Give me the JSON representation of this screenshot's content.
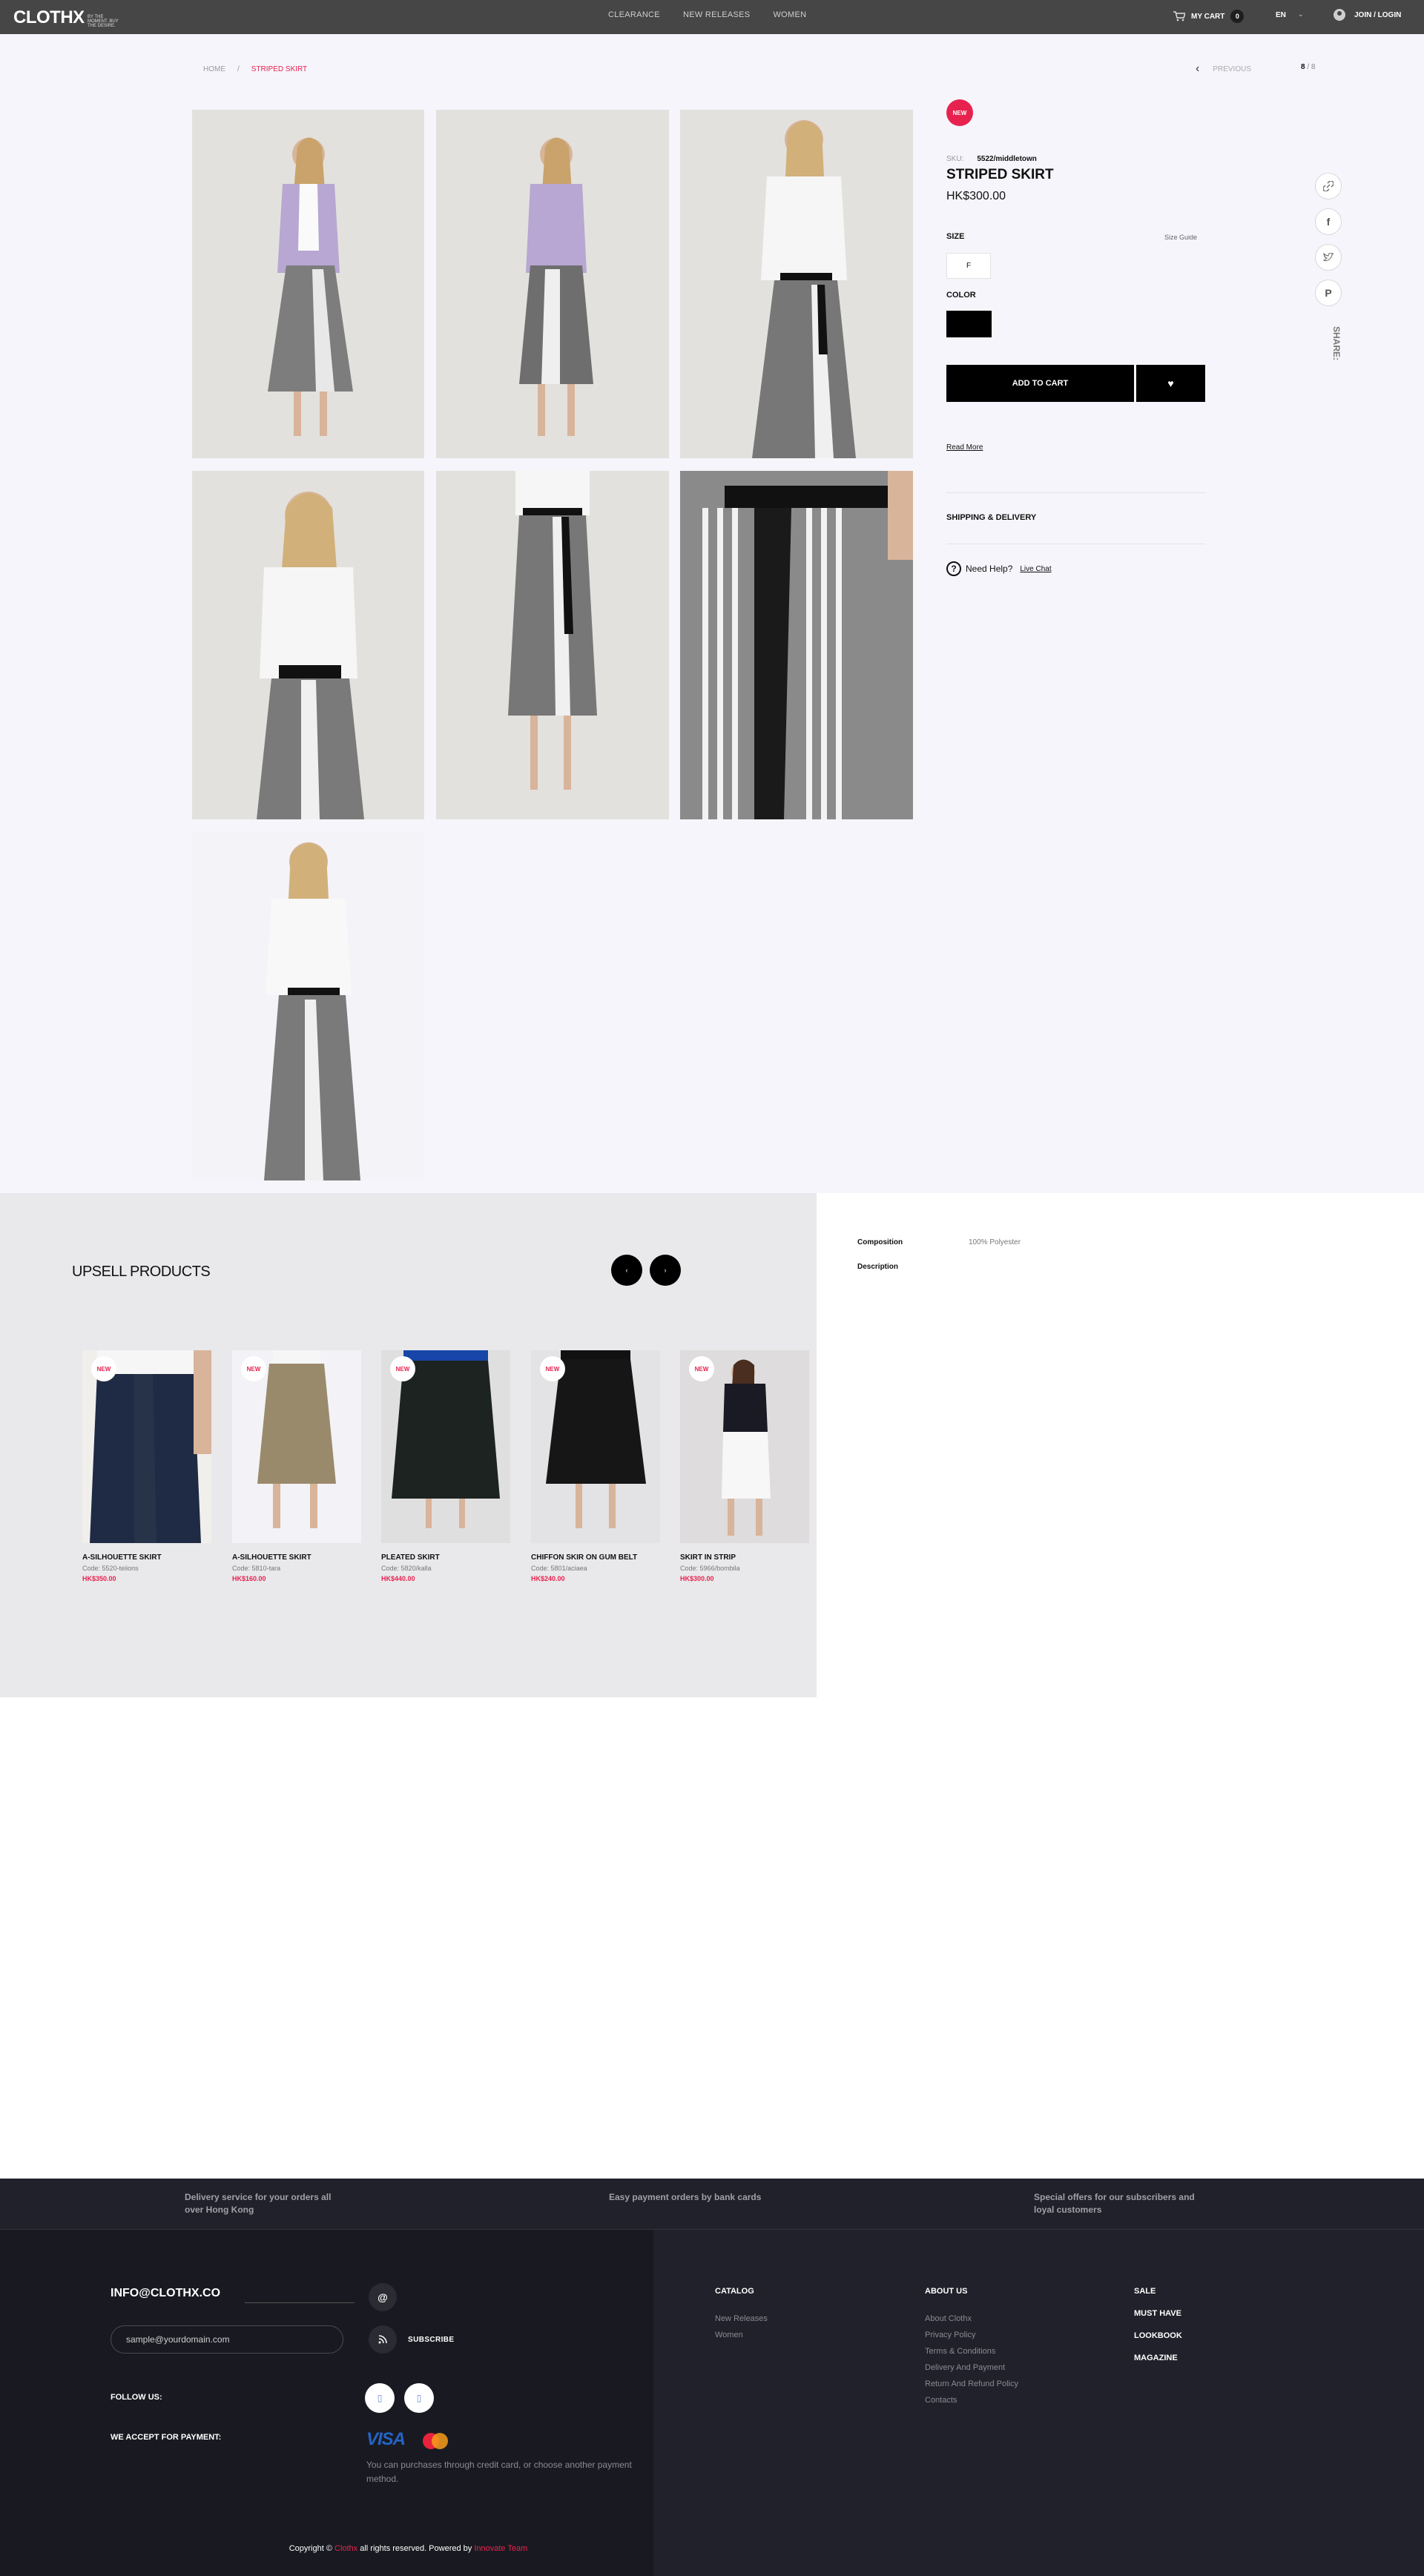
{
  "header": {
    "logo": "CLOTHX",
    "logo_tagline": "BY THE MOMENT. BUY THE DESIRE.",
    "nav": [
      "CLEARANCE",
      "NEW RELEASES",
      "WOMEN"
    ],
    "cart_label": "MY CART",
    "cart_count": "0",
    "language": "EN",
    "login_label": "JOIN / LOGIN"
  },
  "breadcrumb": {
    "home": "HOME",
    "separator": "/",
    "current": "STRIPED SKIRT"
  },
  "pager": {
    "previous": "PREVIOUS",
    "current": "8",
    "total": "/ 8"
  },
  "product": {
    "badge": "NEW",
    "sku_label": "SKU:",
    "sku": "5522/middletown",
    "title": "STRIPED SKIRT",
    "price": "HK$300.00",
    "size_label": "SIZE",
    "size_guide": "Size Guide",
    "size_option": "F",
    "color_label": "COLOR",
    "color_value": "#000000",
    "add_to_cart": "ADD TO CART",
    "read_more": "Read More",
    "shipping": "SHIPPING & DELIVERY",
    "help_text": "Need Help?",
    "live_chat": "Live Chat",
    "share_label": "SHARE:"
  },
  "share": [
    "link-icon",
    "facebook-icon",
    "twitter-icon",
    "pinterest-icon"
  ],
  "upsell": {
    "title": "UPSELL PRODUCTS",
    "prev": "‹",
    "next": "›",
    "badge": "NEW",
    "code_label": "Code:",
    "items": [
      {
        "name": "A-SILHOUETTE SKIRT",
        "code": "5520-teiions",
        "price": "HK$350.00"
      },
      {
        "name": "A-SILHOUETTE SKIRT",
        "code": "5810-tara",
        "price": "HK$160.00"
      },
      {
        "name": "PLEATED SKIRT",
        "code": "5820/kalla",
        "price": "HK$440.00"
      },
      {
        "name": "CHIFFON SKIR ON GUM BELT",
        "code": "5801/aciaea",
        "price": "HK$240.00"
      },
      {
        "name": "SKIRT IN STRIP",
        "code": "5966/bombila",
        "price": "HK$300.00"
      }
    ]
  },
  "details": {
    "composition_label": "Composition",
    "composition_value": "100% Polyester",
    "description_label": "Description"
  },
  "footer": {
    "features": [
      "Delivery service for your orders all over Hong Kong",
      "Easy payment orders by bank cards",
      "Special offers for our subscribers and loyal customers"
    ],
    "email": "INFO@CLOTHX.CO",
    "newsletter_placeholder": "sample@yourdomain.com",
    "subscribe": "SUBSCRIBE",
    "follow_us": "FOLLOW US:",
    "payment_label": "WE ACCEPT FOR PAYMENT:",
    "visa": "VISA",
    "payment_note": "You can purchases through credit card, or choose another payment method.",
    "copyright_pre": "Copyright ©",
    "copyright_brand": "Clothx",
    "copyright_mid": "all rights reserved. Powered by",
    "copyright_team": "Innovate Team",
    "catalog_title": "CATALOG",
    "catalog": [
      "New Releases",
      "Women"
    ],
    "about_title": "ABOUT US",
    "about": [
      "About Clothx",
      "Privacy Policy",
      "Terms & Conditions",
      "Delivery And Payment",
      "Return And Refund Policy",
      "Contacts"
    ],
    "bold_links": [
      "SALE",
      "MUST HAVE",
      "LOOKBOOK",
      "MAGAZINE"
    ]
  }
}
